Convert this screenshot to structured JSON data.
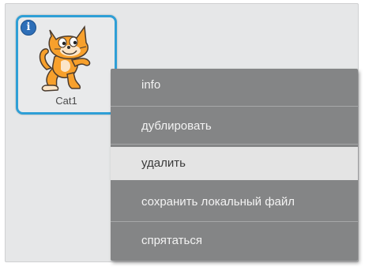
{
  "sprite": {
    "name": "Cat1",
    "info_icon": "info-icon",
    "info_glyph": "i",
    "selected_border_color": "#2f9fd6"
  },
  "context_menu": {
    "items": [
      {
        "label": "info"
      },
      {
        "label": "дублировать"
      },
      {
        "label": "удалить",
        "highlighted": true
      },
      {
        "label": "сохранить локальный файл"
      },
      {
        "label": "спрятаться"
      }
    ]
  },
  "colors": {
    "pane_background": "#e6e7e8",
    "menu_background": "#848586",
    "menu_text": "#f3f3f3",
    "menu_hover_background": "#e4e4e4",
    "info_icon": "#2e6fb8"
  }
}
